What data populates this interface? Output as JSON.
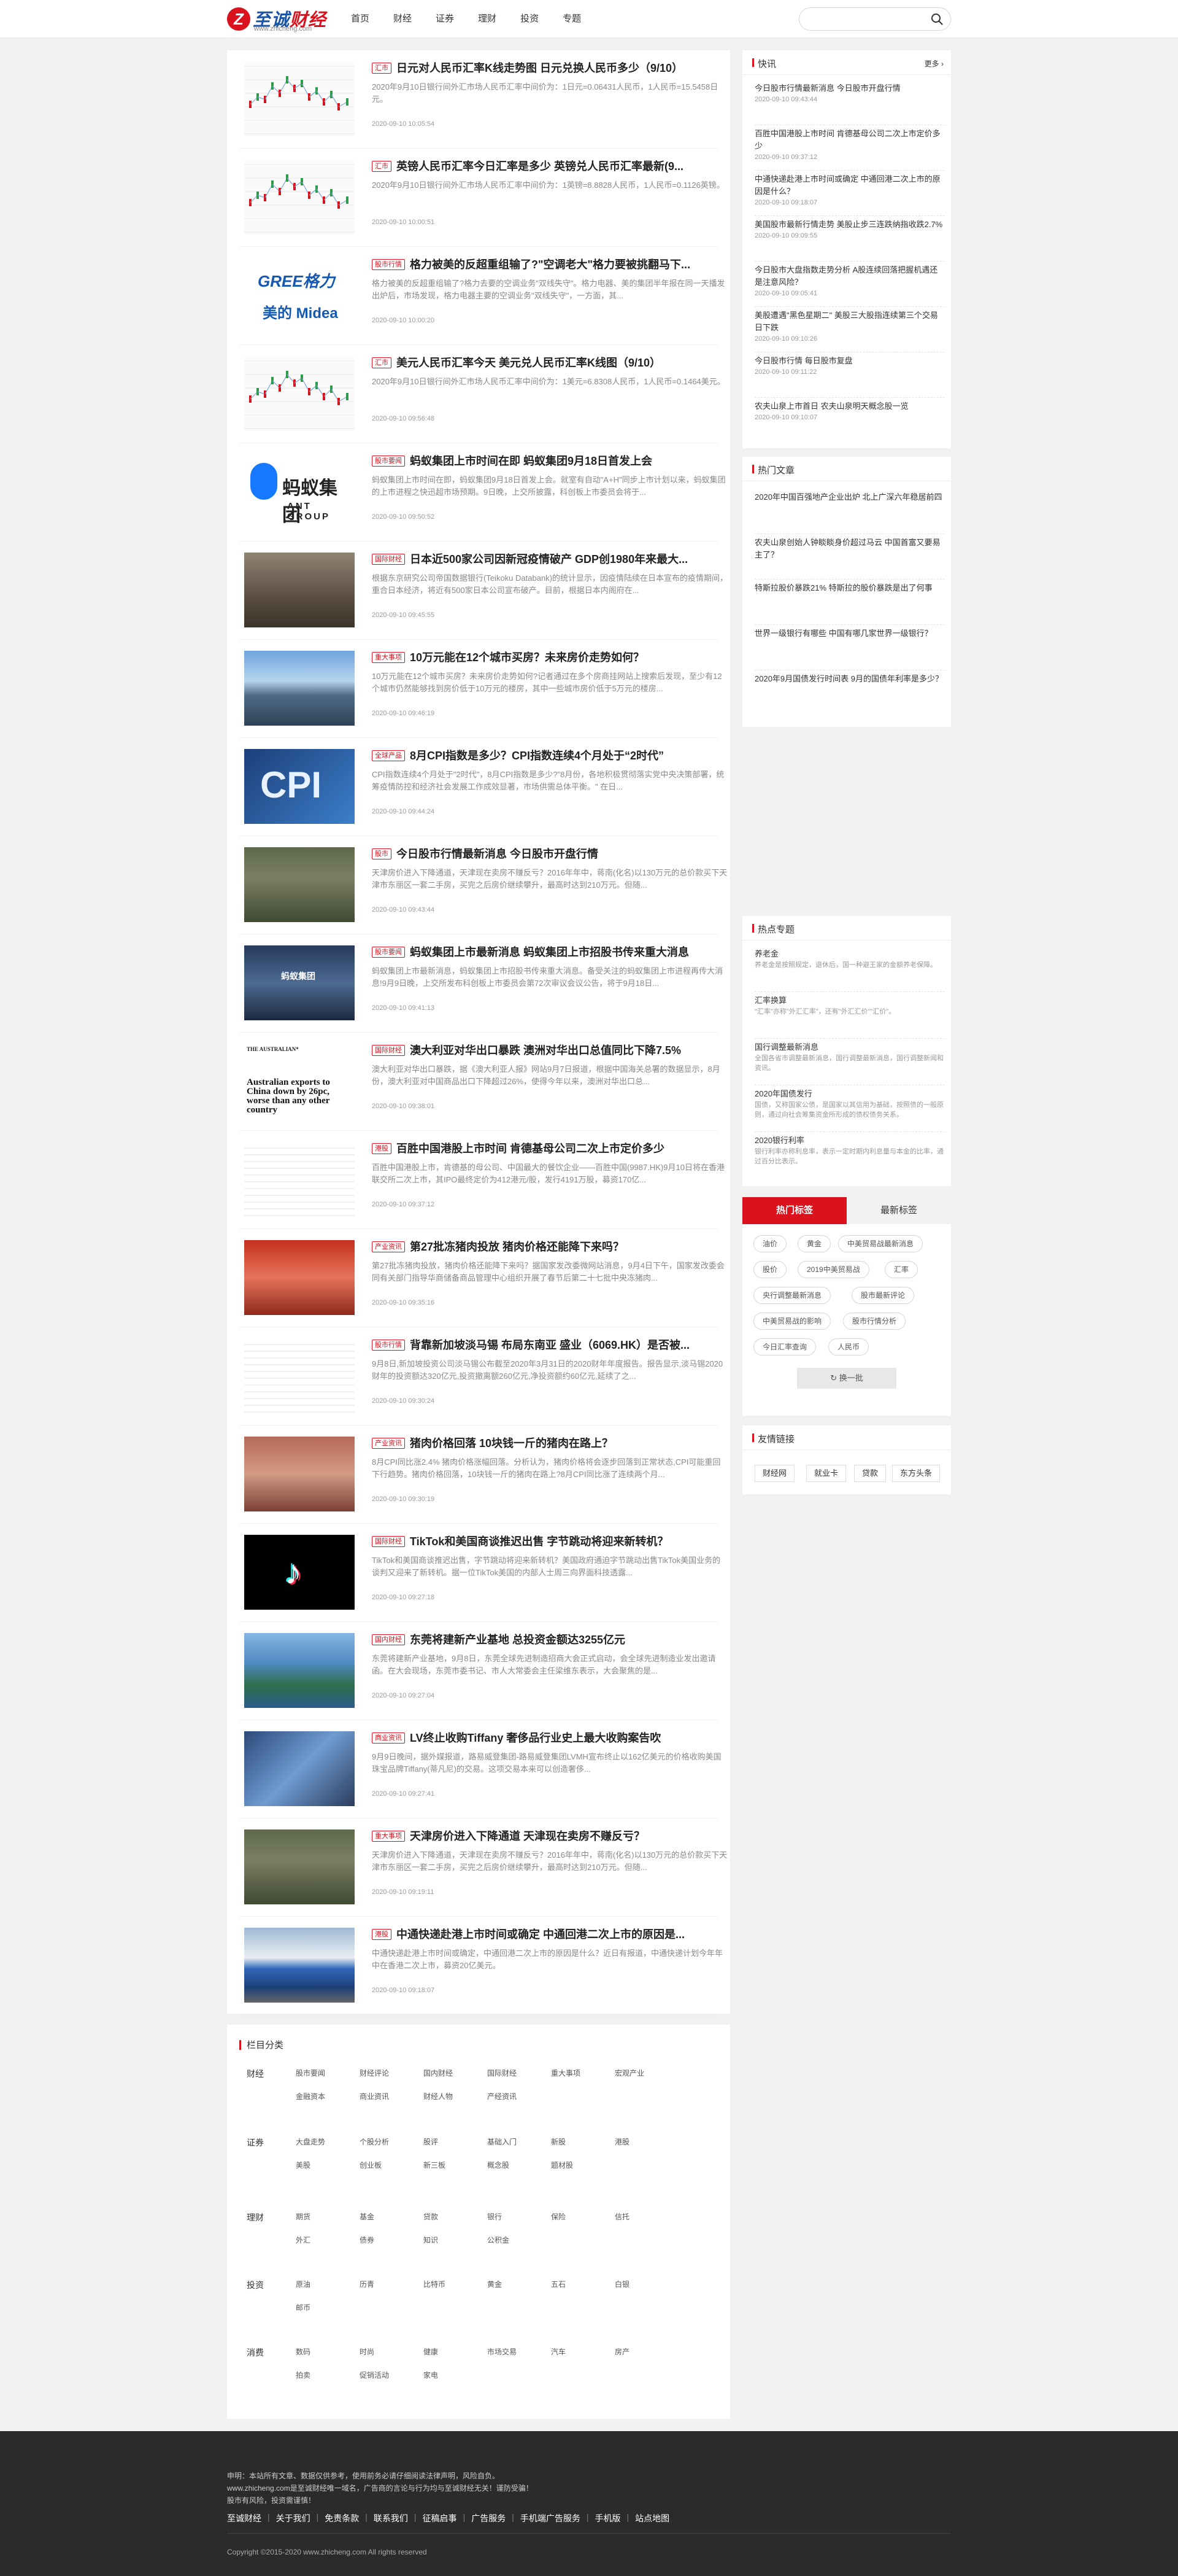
{
  "header": {
    "logo_mark": "Z",
    "logo_name_1": "至诚",
    "logo_name_2": "财经",
    "logo_url": "www.zhicheng.com",
    "nav": [
      "首页",
      "财经",
      "证券",
      "理财",
      "投资",
      "专题"
    ],
    "search_placeholder": ""
  },
  "articles": [
    {
      "tag": "汇市",
      "title": "日元对人民币汇率K线走势图 日元兑换人民币多少（9/10）",
      "desc": "2020年9月10日银行间外汇市场人民币汇率中间价为：1日元=0.06431人民币，1人民币=15.5458日元。",
      "date": "2020-09-10 10:05:54",
      "img": "chart"
    },
    {
      "tag": "汇市",
      "title": "英镑人民币汇率今日汇率是多少 英镑兑人民币汇率最新(9...",
      "desc": "2020年9月10日银行间外汇市场人民币汇率中间价为：1英镑=8.8828人民币，1人民币=0.1126英镑。",
      "date": "2020-09-10 10:00:51",
      "img": "chart"
    },
    {
      "tag": "股市行情",
      "title": "格力被美的反超重组输了?\"空调老大\"格力要被挑翻马下...",
      "desc": "格力被美的反超重组输了?格力去要的空调业务\"双线失守\"。格力电器、美的集团半年报在同一天播发出炉后，市场发现，格力电器主要的空调业务\"双线失守\"，一方面，其...",
      "date": "2020-09-10 10:00:20",
      "img": "gree"
    },
    {
      "tag": "汇市",
      "title": "美元人民币汇率今天 美元兑人民币汇率K线图（9/10）",
      "desc": "2020年9月10日银行间外汇市场人民币汇率中间价为：1美元=6.8308人民币，1人民币=0.1464美元。",
      "date": "2020-09-10 09:56:48",
      "img": "chart"
    },
    {
      "tag": "股市要闻",
      "title": "蚂蚁集团上市时间在即 蚂蚁集团9月18日首发上会",
      "desc": "蚂蚁集团上市时间在即，蚂蚁集团9月18日首发上会。就室有自动\"A+H\"同步上市计划以来，蚂蚁集团的上市进程之快迅超市场预期。9日晚，上交所披露，科创板上市委员会将于...",
      "date": "2020-09-10 09:50:52",
      "img": "ant"
    },
    {
      "tag": "国际财经",
      "title": "日本近500家公司因新冠疫情破产 GDP创1980年来最大...",
      "desc": "根据东京研究公司帝国数据银行(Teikoku Databank)的统计显示，因疫情陆续在日本宣布的疫情期间，重合日本经济，将近有500家日本公司宣布破产。目前，根据日本内阁府在...",
      "date": "2020-09-10 09:45:55",
      "img": "street"
    },
    {
      "tag": "重大事项",
      "title": "10万元能在12个城市买房？未来房价走势如何？",
      "desc": "10万元能在12个城市买房？未来房价走势如何?记者通过在多个房商挂网站上搜索后发现，至少有12个城市仍然能够找到房价低于10万元的楼房，其中一些城市房价低于5万元的楼房...",
      "date": "2020-09-10 09:46:19",
      "img": "city"
    },
    {
      "tag": "全球产品",
      "title": "8月CPI指数是多少？CPI指数连续4个月处于“2时代”",
      "desc": "CPI指数连续4个月处于\"2时代\"，8月CPI指数是多少?\"8月份，各地积极贯彻落实党中央决策部署，统筹疫情防控和经济社会发展工作成效显著，市场供需总体平衡。\" 在日...",
      "date": "2020-09-10 09:44:24",
      "img": "cpi"
    },
    {
      "tag": "股市",
      "title": "今日股市行情最新消息 今日股市开盘行情",
      "desc": "天津房价进入下降通道，天津现在卖房不赚反亏？2016年年中，蒋南(化名)以130万元的总价款买下天津市东丽区一套二手房，买完之后房价继续攀升，最高时达到210万元。但随...",
      "date": "2020-09-10 09:43:44",
      "img": "aerial"
    },
    {
      "tag": "股市要闻",
      "title": "蚂蚁集团上市最新消息 蚂蚁集团上市招股书传来重大消息",
      "desc": "蚂蚁集团上市最新消息，蚂蚁集团上市招股书传来重大消息。备受关注的蚂蚁集团上市进程再传大消息!9月9日晚，上交所发布科创板上市委员会第72次审议会议公告，将于9月18日...",
      "date": "2020-09-10 09:41:13",
      "img": "antbld"
    },
    {
      "tag": "国际财经",
      "title": "澳大利亚对华出口暴跌 澳洲对华出口总值同比下降7.5%",
      "desc": "澳大利亚对华出口暴跌，据《澳大利亚人报》网站9月7日报道，根据中国海关总署的数据显示，8月份，澳大利亚对中国商品出口下降超过26%，使得今年以来，澳洲对华出口总...",
      "date": "2020-09-10 09:38:01",
      "img": "news"
    },
    {
      "tag": "港股",
      "title": "百胜中国港股上市时间 肯德基母公司二次上市定价多少",
      "desc": "百胜中国港股上市，肯德基的母公司、中国最大的餐饮企业——百胜中国(9987.HK)9月10日将在香港联交所二次上市，其IPO最终定价为412港元/股，发行4191万股，募资170亿...",
      "date": "2020-09-10 09:37:12",
      "img": "tablepic"
    },
    {
      "tag": "产业资讯",
      "title": "第27批冻猪肉投放 猪肉价格还能降下来吗？",
      "desc": "第27批冻猪肉投放，猪肉价格还能降下来吗？据国家发改委微网站消息，9月4日下午，国家发改委会同有关部门指导华商储备商品管理中心组织开展了春节后第二十七批中央冻猪肉...",
      "date": "2020-09-10 09:35:16",
      "img": "pork"
    },
    {
      "tag": "股市行情",
      "title": "背靠新加坡淡马锡 布局东南亚 盛业（6069.HK）是否被...",
      "desc": "9月8日,新加坡投资公司淡马锡公布截至2020年3月31日的2020财年年度报告。报告显示,淡马锡2020财年的投资额达320亿元,投资撤离额260亿元,净投资额约60亿元,延续了之...",
      "date": "2020-09-10 09:30:24",
      "img": "tablepic"
    },
    {
      "tag": "产业资讯",
      "title": "猪肉价格回落 10块钱一斤的猪肉在路上？",
      "desc": "8月CPI同比涨2.4% 猪肉价格涨幅回落。分析认为，猪肉价格将会逐步回落到正常状态,CPI可能重回下行趋势。猪肉价格回落，10块钱一斤的猪肉在路上?8月CPI同比涨了连续两个月...",
      "date": "2020-09-10 09:30:19",
      "img": "pork2"
    },
    {
      "tag": "国际财经",
      "title": "TikTok和美国商谈推迟出售 字节跳动将迎来新转机？",
      "desc": "TikTok和美国商谈推迟出售，字节跳动将迎来新转机？美国政府通迫字节跳动出售TikTok美国业务的谈判又迎来了新转机。据一位TikTok美国的内部人士周三向界面科技透露...",
      "date": "2020-09-10 09:27:18",
      "img": "tiktok"
    },
    {
      "tag": "国内财经",
      "title": "东莞将建新产业基地 总投资金额达3255亿元",
      "desc": "东莞将建新产业基地，9月8日，东莞全球先进制造招商大会正式启动，会全球先进制造业发出邀请函。在大会现场，东莞市委书记、市人大常委会主任梁维东表示，大会聚焦的是...",
      "date": "2020-09-10 09:27:04",
      "img": "dongguan"
    },
    {
      "tag": "商业资讯",
      "title": "LV终止收购Tiffany 奢侈品行业史上最大收购案告吹",
      "desc": "9月9日晚间，据外媒报道，路易威登集团-路易威登集团LVMH宣布终止以162亿美元的价格收购美国珠宝品牌Tiffany(蒂凡尼)的交易。这项交易本来可以创造奢侈...",
      "date": "2020-09-10 09:27:41",
      "img": "lvbld"
    },
    {
      "tag": "重大事项",
      "title": "天津房价进入下降通道 天津现在卖房不赚反亏？",
      "desc": "天津房价进入下降通道，天津现在卖房不赚反亏？2016年年中，蒋南(化名)以130万元的总价款买下天津市东丽区一套二手房，买完之后房价继续攀升，最高时达到210万元。但随...",
      "date": "2020-09-10 09:19:11",
      "img": "aerial"
    },
    {
      "tag": "港股",
      "title": "中通快递赴港上市时间或确定 中通回港二次上市的原因是...",
      "desc": "中通快递赴港上市时间或确定，中通回港二次上市的原因是什么？近日有报道，中通快递计划今年年中在香港二次上市，募资20亿美元。",
      "date": "2020-09-10 09:18:07",
      "img": "truck"
    }
  ],
  "flash": {
    "title": "快讯",
    "more": "更多",
    "items": [
      {
        "text": "今日股市行情最新消息 今日股市开盘行情",
        "date": "2020-09-10 09:43:44"
      },
      {
        "text": "百胜中国港股上市时间 肯德基母公司二次上市定价多少",
        "date": "2020-09-10 09:37:12"
      },
      {
        "text": "中通快递赴港上市时间或确定 中通回港二次上市的原因是什么？",
        "date": "2020-09-10 09:18:07"
      },
      {
        "text": "美国股市最新行情走势 美股止步三连跌纳指收跌2.7%",
        "date": "2020-09-10 09:09:55"
      },
      {
        "text": "今日股市大盘指数走势分析 A股连续回落把握机遇还是注意风险？",
        "date": "2020-09-10 09:05:41"
      },
      {
        "text": "美股遭遇\"黑色星期二\" 美股三大股指连续第三个交易日下跌",
        "date": "2020-09-10 09:10:26"
      },
      {
        "text": "今日股市行情 每日股市复盘",
        "date": "2020-09-10 09:11:22"
      },
      {
        "text": "农夫山泉上市首日 农夫山泉明天概念股一览",
        "date": "2020-09-10 09:10:07"
      }
    ]
  },
  "hot_articles": {
    "title": "热门文章",
    "items": [
      "2020年中国百强地产企业出炉 北上广深六年稳居前四",
      "农夫山泉创始人钟睒睒身价超过马云 中国首富又要易主了？",
      "特斯拉股价暴跌21% 特斯拉的股价暴跌是出了何事",
      "世界一级银行有哪些 中国有哪几家世界一级银行？",
      "2020年9月国债发行时间表 9月的国债年利率是多少？"
    ]
  },
  "hot_topics": {
    "title": "热点专题",
    "items": [
      {
        "title": "养老金",
        "desc": "养老金是按照规定，退休后，国一种避王家的金额养老保障。"
      },
      {
        "title": "汇率换算",
        "desc": "\"汇率\"亦称\"外汇汇率\"，还有\"外汇汇价\"\"汇价\"。"
      },
      {
        "title": "国行调整最新消息",
        "desc": "全国各省市调整最新消息，国行调整最新消息，国行调整新闻和资讯。"
      },
      {
        "title": "2020年国债发行",
        "desc": "国债，又称国家公债，是国家以其信用为基础，按照债的一般原则，通过向社会筹集资金所形成的债权债务关系。"
      },
      {
        "title": "2020银行利率",
        "desc": "银行利率亦称利息率，表示一定时期内利息量与本金的比率，通过百分比表示。"
      }
    ]
  },
  "tags": {
    "tab_on": "热门标签",
    "tab_off": "最新标签",
    "items": [
      "油价",
      "黄金",
      "中美贸易战最新消息",
      "股价",
      "2019中美贸易战",
      "汇率",
      "央行调整最新消息",
      "股市最新评论",
      "中美贸易战的影响",
      "股市行情分析",
      "今日汇率查询",
      "人民币"
    ],
    "swap": "换一批"
  },
  "links": {
    "title": "友情链接",
    "items": [
      "财经网",
      "就业卡",
      "贷款",
      "东方头条"
    ]
  },
  "categories": {
    "title": "栏目分类",
    "groups": [
      {
        "label": "财经",
        "items": [
          "股市要闻",
          "财经评论",
          "国内财经",
          "国际财经",
          "重大事项",
          "宏观产业",
          "金融资本",
          "商业资讯",
          "财经人物",
          "产经资讯"
        ]
      },
      {
        "label": "证券",
        "items": [
          "大盘走势",
          "个股分析",
          "股评",
          "基础入门",
          "新股",
          "港股",
          "美股",
          "创业板",
          "新三板",
          "概念股",
          "题材股"
        ]
      },
      {
        "label": "理财",
        "items": [
          "期货",
          "基金",
          "贷款",
          "银行",
          "保险",
          "信托",
          "外汇",
          "债券",
          "知识",
          "公积金"
        ]
      },
      {
        "label": "投资",
        "items": [
          "原油",
          "历青",
          "比特币",
          "黄金",
          "五石",
          "白银",
          "邮币"
        ]
      },
      {
        "label": "消费",
        "items": [
          "数码",
          "时尚",
          "健康",
          "市场交易",
          "汽车",
          "房产",
          "拍卖",
          "促销活动",
          "家电"
        ]
      }
    ]
  },
  "footer": {
    "line1": "申明：本站所有文章、数据仅供参考，使用前务必请仔细阅读法律声明，风险自负。",
    "line2": "www.zhicheng.com是至诚财经唯一域名，广告商的言论与行为均与至诚财经无关！谨防受骗！",
    "line3": "股市有风险，投资需谨慎！",
    "links": [
      "至诚财经",
      "关于我们",
      "免责条款",
      "联系我们",
      "征稿启事",
      "广告服务",
      "手机端广告服务",
      "手机版",
      "站点地图"
    ],
    "copyright": "Copyright ©2015-2020 www.zhicheng.com All rights reserved"
  },
  "colors": {
    "accent": "#d9121d",
    "logo_blue": "#1d55a6",
    "footer_bg": "#2b2b2b"
  }
}
